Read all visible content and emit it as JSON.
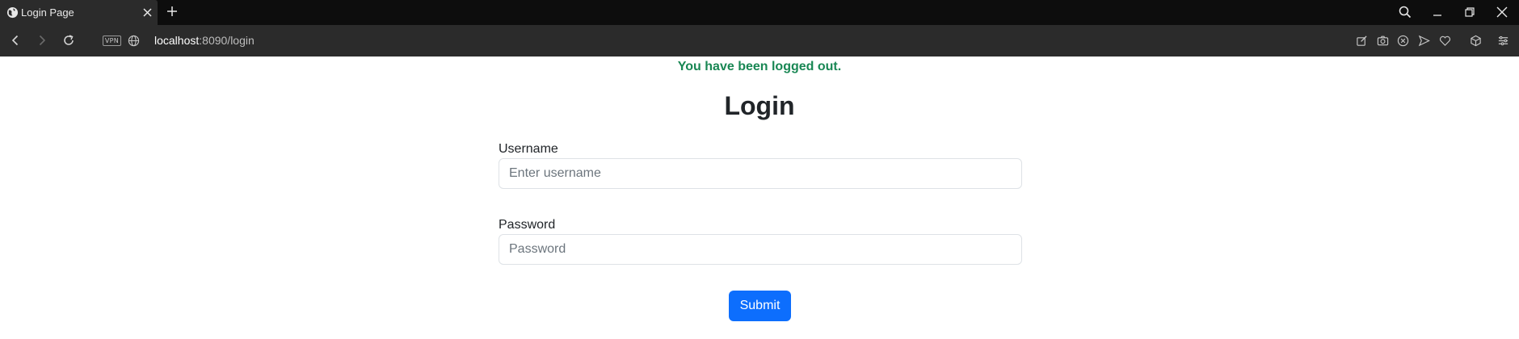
{
  "browser": {
    "tab": {
      "title": "Login Page",
      "favicon": "globe-icon",
      "close": "close-icon"
    },
    "new_tab": "plus-icon",
    "window_controls": [
      "search-icon",
      "minimize-icon",
      "restore-icon",
      "close-icon"
    ],
    "nav": [
      "back-icon",
      "forward-icon",
      "reload-icon"
    ],
    "vpn_badge": "VPN",
    "site_info": "globe-icon",
    "url": {
      "host": "localhost",
      "rest": ":8090/login"
    },
    "toolbar_icons": [
      "edit-icon",
      "camera-icon",
      "ad-block-icon",
      "send-icon",
      "heart-icon",
      "cube-icon",
      "menu-icon"
    ]
  },
  "page": {
    "flash_message": "You have been logged out.",
    "heading": "Login",
    "username": {
      "label": "Username",
      "placeholder": "Enter username",
      "value": ""
    },
    "password": {
      "label": "Password",
      "placeholder": "Password",
      "value": ""
    },
    "submit_label": "Submit"
  },
  "colors": {
    "success": "#198754",
    "primary": "#0d6efd",
    "chrome_dark": "#0d0d0d",
    "chrome": "#2b2b2b"
  }
}
